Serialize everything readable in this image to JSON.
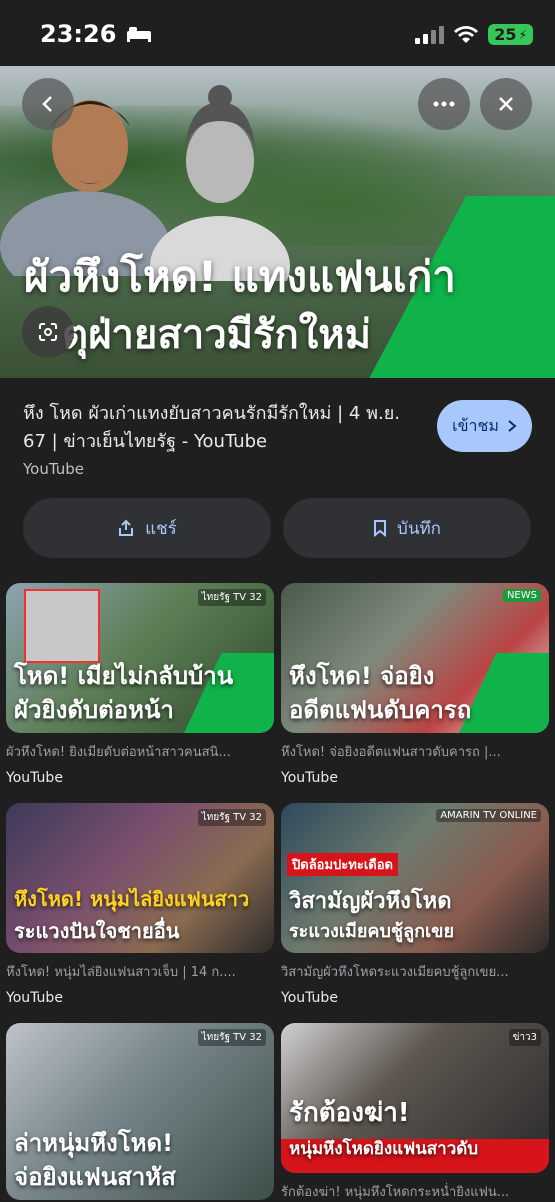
{
  "status_bar": {
    "time": "23:26",
    "battery": "25"
  },
  "hero": {
    "title": "ผัวหึงโหด! แทงแฟนเก่า",
    "subtitle": "ตุฝ่ายสาวมีรักใหม่"
  },
  "result": {
    "title": "หึง โหด ผัวเก่าแทงยับสาวคนรักมีรักใหม่ | 4 พ.ย. 67 | ข่าวเย็นไทยรัฐ - YouTube",
    "source": "YouTube",
    "visit_label": "เข้าชม",
    "share_label": "แชร์",
    "save_label": "บันทึก"
  },
  "related": [
    {
      "caption1": "โหด! เมียไม่กลับบ้าน",
      "caption2": "ผัวยิงดับต่อหน้า",
      "title": "ผัวหึงโหด! ยิงเมียดับต่อหน้าสาวคนสนิ...",
      "source": "YouTube",
      "logo": "ไทยรัฐ TV 32"
    },
    {
      "caption1": "หึงโหด! จ่อยิง",
      "caption2": "อดีตแฟนดับคารถ",
      "title": "หึงโหด! จ่อยิงอดีตแฟนสาวดับคารถ |...",
      "source": "YouTube",
      "logo": "NEWS"
    },
    {
      "caption1": "หึงโหด! หนุ่มไล่ยิงแฟนสาว",
      "caption2": "ระแวงปันใจชายอื่น",
      "title": "หึงโหด! หนุ่มไล่ยิงแฟนสาวเจ็บ | 14 ก....",
      "source": "YouTube",
      "logo": "ไทยรัฐ TV 32"
    },
    {
      "caption1": "ปิดล้อมปะทะเดือด",
      "caption2": "วิสามัญผัวหึงโหด",
      "caption3": "ระแวงเมียคบชู้ลูกเขย",
      "title": "วิสามัญผัวหึงโหดระแวงเมียคบชู้ลูกเขย...",
      "source": "YouTube",
      "logo": "AMARIN TV ONLINE"
    },
    {
      "caption1": "ล่าหนุ่มหึงโหด!",
      "caption2": "จ่อยิงแฟนสาหัส",
      "title": "",
      "source": "",
      "logo": "ไทยรัฐ TV 32"
    },
    {
      "caption1": "รักต้องฆ่า!",
      "caption2": "หนุ่มหึงโหดยิงแฟนสาวดับ",
      "title": "รักต้องฆ่า! หนุ่มหึงโหดกระหน่ำยิงแฟน...",
      "source": "",
      "logo": "ข่าว3"
    }
  ],
  "icons": [
    "bed-icon",
    "signal-icon",
    "wifi-icon",
    "battery-icon",
    "back-icon",
    "more-icon",
    "close-icon",
    "lens-icon",
    "share-icon",
    "bookmark-icon",
    "chevron-right-icon"
  ],
  "colors": {
    "accent": "#a8c7fa",
    "background": "#1f1f1f",
    "button": "#303134"
  }
}
